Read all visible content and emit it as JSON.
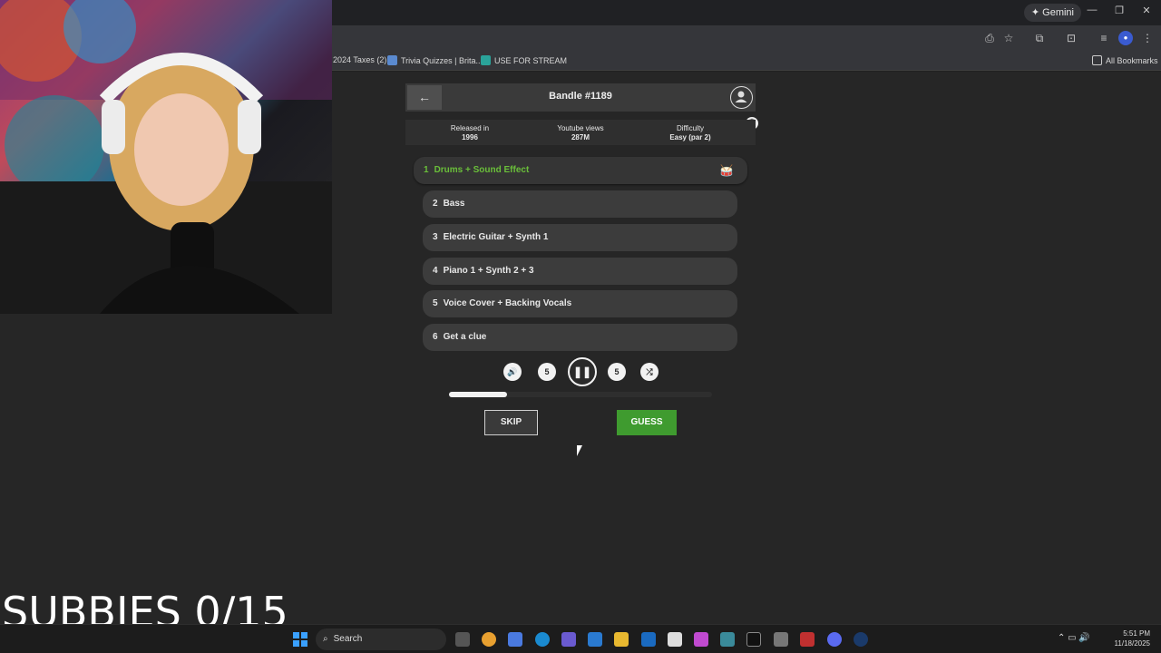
{
  "browser": {
    "gemini_label": "Gemini",
    "bookmarks": [
      {
        "label": "2024 Taxes (2)"
      },
      {
        "label": "Trivia Quizzes | Brita..."
      },
      {
        "label": "USE FOR STREAM"
      }
    ],
    "all_bookmarks": "All Bookmarks"
  },
  "game": {
    "title": "Bandle #1189",
    "info": [
      {
        "label": "Released in",
        "value": "1996"
      },
      {
        "label": "Youtube views",
        "value": "287M"
      },
      {
        "label": "Difficulty",
        "value": "Easy (par 2)"
      }
    ],
    "tracks": [
      {
        "num": "1",
        "label": "Drums + Sound Effect",
        "active": true
      },
      {
        "num": "2",
        "label": "Bass"
      },
      {
        "num": "3",
        "label": "Electric Guitar + Synth 1"
      },
      {
        "num": "4",
        "label": "Piano 1 + Synth 2 + 3"
      },
      {
        "num": "5",
        "label": "Voice Cover + Backing Vocals"
      },
      {
        "num": "6",
        "label": "Get a clue"
      }
    ],
    "controls": {
      "rewind_label": "5",
      "forward_label": "5"
    },
    "progress_fraction": 0.22,
    "skip_label": "SKIP",
    "guess_label": "GUESS",
    "accent_color": "#6abf3a",
    "guess_color": "#3f9b2f"
  },
  "overlay": {
    "subbies_text": "SUBBIES 0/15"
  },
  "taskbar": {
    "search_label": "Search",
    "time": "5:51 PM",
    "date": "11/18/2025"
  }
}
